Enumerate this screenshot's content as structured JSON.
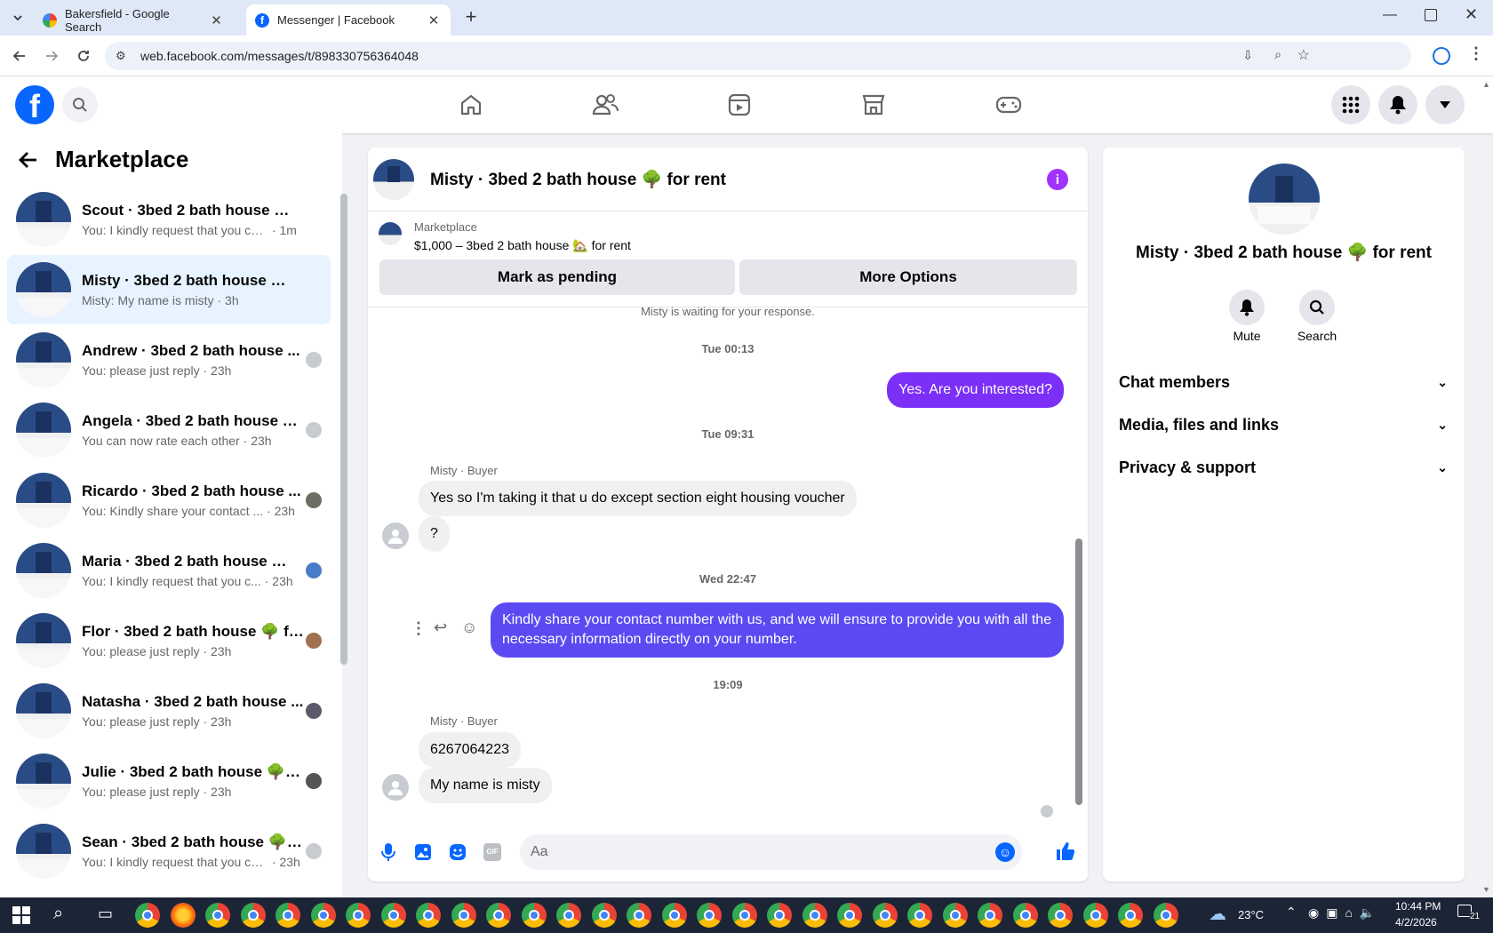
{
  "browser": {
    "tabs": [
      {
        "title": "Bakersfield - Google Search",
        "active": false
      },
      {
        "title": "Messenger | Facebook",
        "active": true
      }
    ],
    "new_tab_label": "+",
    "url": "web.facebook.com/messages/t/898330756364048"
  },
  "sidebar": {
    "title": "Marketplace",
    "conversations": [
      {
        "name": "Scout · 3bed 2 bath house 🌳 fo...",
        "preview": "You: I kindly request that you comp...",
        "time": "1m",
        "selected": false
      },
      {
        "name": "Misty · 3bed 2 bath house 🌳 for...",
        "preview": "Misty: My name is misty",
        "time": "3h",
        "selected": true
      },
      {
        "name": "Andrew · 3bed 2 bath house ...",
        "preview": "You: please just reply",
        "time": "23h",
        "selected": false
      },
      {
        "name": "Angela · 3bed 2 bath house 🌳 f...",
        "preview": "You can now rate each other",
        "time": "23h",
        "selected": false
      },
      {
        "name": "Ricardo · 3bed 2 bath house ...",
        "preview": "You: Kindly share your contact ...",
        "time": "23h",
        "selected": false
      },
      {
        "name": "Maria · 3bed 2 bath house 🌳 ...",
        "preview": "You: I kindly request that you c...",
        "time": "23h",
        "selected": false
      },
      {
        "name": "Flor · 3bed 2 bath house 🌳 fo...",
        "preview": "You: please just reply",
        "time": "23h",
        "selected": false
      },
      {
        "name": "Natasha · 3bed 2 bath house ...",
        "preview": "You: please just reply",
        "time": "23h",
        "selected": false
      },
      {
        "name": "Julie · 3bed 2 bath house 🌳 f...",
        "preview": "You: please just reply",
        "time": "23h",
        "selected": false
      },
      {
        "name": "Sean · 3bed 2 bath house 🌳 for ...",
        "preview": "You: I kindly request that you com...",
        "time": "23h",
        "selected": false
      }
    ]
  },
  "chat": {
    "title": "Misty · 3bed 2 bath house 🌳 for rent",
    "listing_source": "Marketplace",
    "listing_detail": "$1,000 – 3bed 2 bath house 🏡 for rent",
    "mark_pending_label": "Mark as pending",
    "more_options_label": "More Options",
    "waiting_text": "Misty is waiting for your response.",
    "stamp1": "Tue 00:13",
    "msg_out1": "Yes. Are you interested?",
    "stamp2": "Tue 09:31",
    "sender1": "Misty · Buyer",
    "msg_in1": "Yes so I'm taking it that u do except section eight housing voucher",
    "msg_in2": "?",
    "stamp3": "Wed 22:47",
    "msg_out2": "Kindly share your contact number with us, and we will ensure to provide you with all the necessary information directly on your number.",
    "stamp4": "19:09",
    "sender2": "Misty · Buyer",
    "msg_in3": "6267064223",
    "msg_in4": "My name is misty",
    "composer_placeholder": "Aa"
  },
  "details": {
    "title": "Misty · 3bed 2 bath house 🌳 for rent",
    "mute_label": "Mute",
    "search_label": "Search",
    "sections": [
      "Chat members",
      "Media, files and links",
      "Privacy & support"
    ]
  },
  "taskbar": {
    "weather": "23°C",
    "time": "10:44 PM",
    "date": "4/2/2026",
    "notifications": "21"
  },
  "colors": {
    "accent": "#0866ff",
    "outgoing_bubble": "#7b2ff7",
    "outgoing_bubble_2": "#5b4af2",
    "details_icon": "#a033ff"
  }
}
